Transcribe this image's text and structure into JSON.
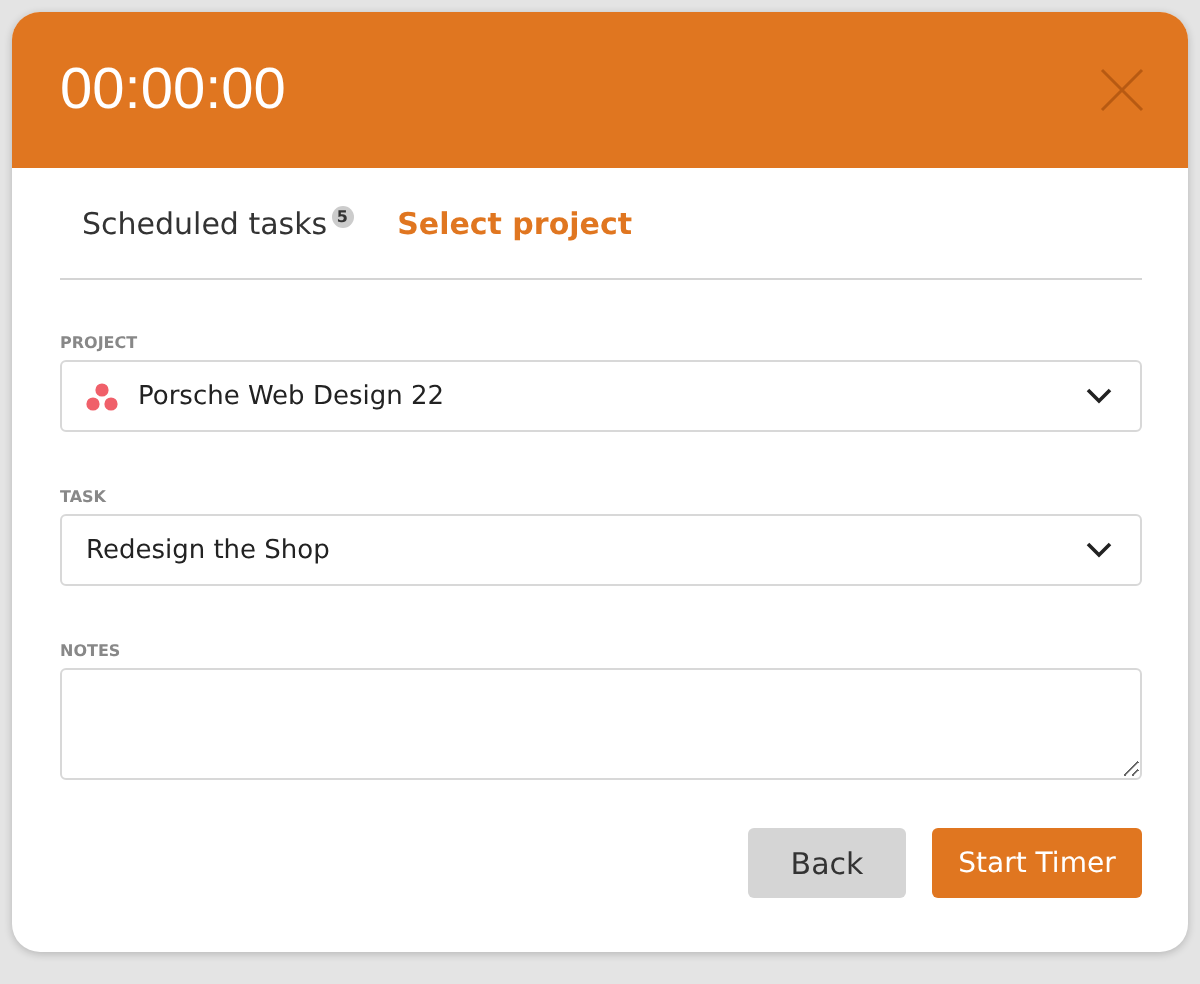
{
  "header": {
    "timer": "00:00:00"
  },
  "tabs": [
    {
      "label": "Scheduled tasks",
      "badge": "5",
      "selected": false
    },
    {
      "label": "Select project",
      "selected": true
    }
  ],
  "fields": [
    {
      "kind": "select",
      "label": "PROJECT",
      "value": "Porsche Web Design 22",
      "has_icon": true
    },
    {
      "kind": "select",
      "label": "TASK",
      "value": "Redesign the Shop",
      "has_icon": false
    },
    {
      "kind": "textarea",
      "label": "NOTES"
    }
  ],
  "buttons": [
    {
      "label": "Back",
      "kind": "secondary"
    },
    {
      "label": "Start Timer",
      "kind": "primary"
    }
  ]
}
